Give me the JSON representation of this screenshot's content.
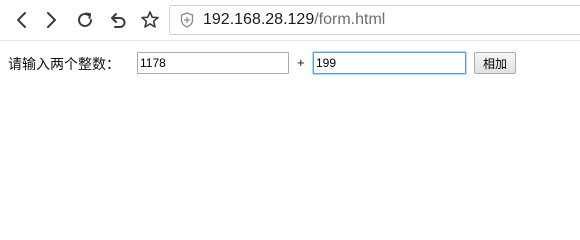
{
  "browser": {
    "nav_icons": [
      "back-icon",
      "forward-icon",
      "reload-icon",
      "undo-icon",
      "bookmark-star-icon"
    ],
    "address_bar": {
      "security_icon": "shield-icon",
      "host": "192.168.28.129",
      "path": "/form.html"
    }
  },
  "form": {
    "prompt_label": "请输入两个整数：",
    "first_number": "1178",
    "operator": "+",
    "second_number": "199",
    "submit_label": "相加"
  },
  "colors": {
    "focus_border": "#5b9dd9",
    "url_host": "#1b1b1b",
    "url_path": "#6e6e6e"
  }
}
